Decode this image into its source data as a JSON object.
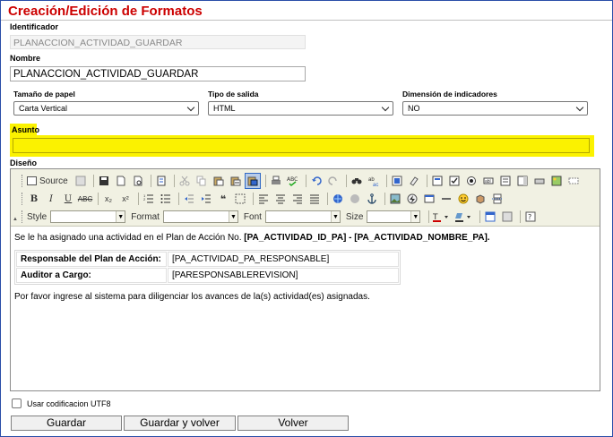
{
  "page": {
    "title": "Creación/Edición de Formatos"
  },
  "form": {
    "identificador": {
      "label": "Identificador",
      "value": "PLANACCION_ACTIVIDAD_GUARDAR"
    },
    "nombre": {
      "label": "Nombre",
      "value": "PLANACCION_ACTIVIDAD_GUARDAR"
    },
    "tamano_papel": {
      "label": "Tamaño de papel",
      "value": "Carta Vertical"
    },
    "tipo_salida": {
      "label": "Tipo de salida",
      "value": "HTML"
    },
    "dimension_indicadores": {
      "label": "Dimensión de indicadores",
      "value": "NO"
    },
    "asunto": {
      "label": "Asunto",
      "value": ""
    },
    "diseno": {
      "label": "Diseño"
    },
    "utf8": {
      "label": "Usar codificacion UTF8",
      "checked": false
    }
  },
  "editor": {
    "toolbar": {
      "source_label": "Source",
      "style_label": "Style",
      "format_label": "Format",
      "font_label": "Font",
      "size_label": "Size"
    },
    "body": {
      "intro_text": "Se le ha asignado una actividad en el Plan de Acción No. ",
      "intro_bold": "[PA_ACTIVIDAD_ID_PA] - [PA_ACTIVIDAD_NOMBRE_PA].",
      "rows": [
        {
          "key": "Responsable del Plan de Acción:",
          "value": "[PA_ACTIVIDAD_PA_RESPONSABLE]"
        },
        {
          "key": "Auditor a Cargo:",
          "value": "[PARESPONSABLEREVISION]"
        }
      ],
      "footer_text": "Por favor ingrese al sistema para diligenciar los avances de la(s) actividad(es) asignadas."
    }
  },
  "buttons": {
    "guardar": "Guardar",
    "guardar_volver": "Guardar y volver",
    "volver": "Volver"
  },
  "colors": {
    "title": "#cc0000",
    "highlight": "#fbf200",
    "frame": "#2a4ea8"
  }
}
